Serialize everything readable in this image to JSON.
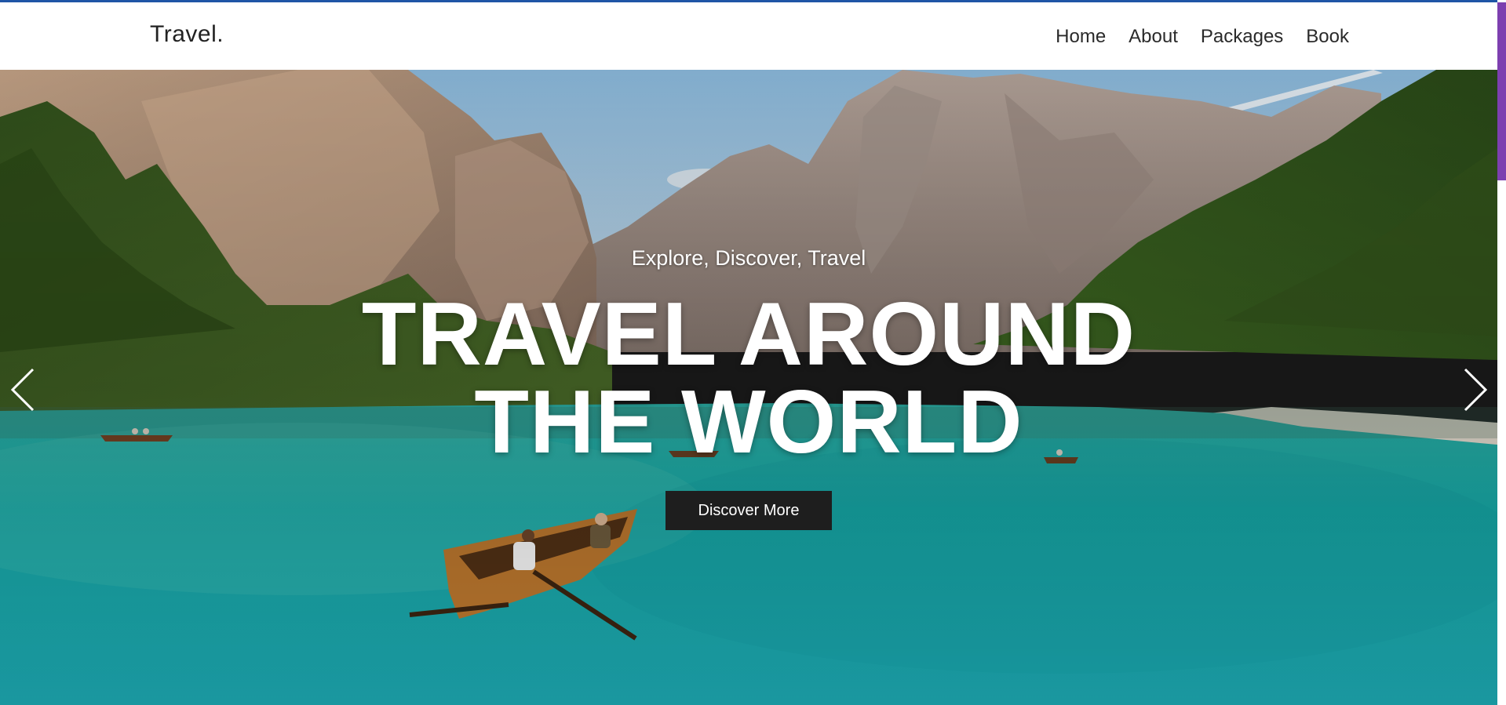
{
  "header": {
    "brand": "Travel.",
    "nav": [
      "Home",
      "About",
      "Packages",
      "Book"
    ]
  },
  "hero": {
    "subtitle": "Explore, Discover, Travel",
    "headline_line1": "TRAVEL AROUND",
    "headline_line2": "THE WORLD",
    "cta_label": "Discover More",
    "prev_icon": "chevron-left-icon",
    "next_icon": "chevron-right-icon"
  },
  "colors": {
    "top_accent": "#1f55a6",
    "scrollbar_thumb": "#7d3fb0",
    "cta_bg": "#1e1e1e",
    "lake": "#1fb1ac"
  }
}
